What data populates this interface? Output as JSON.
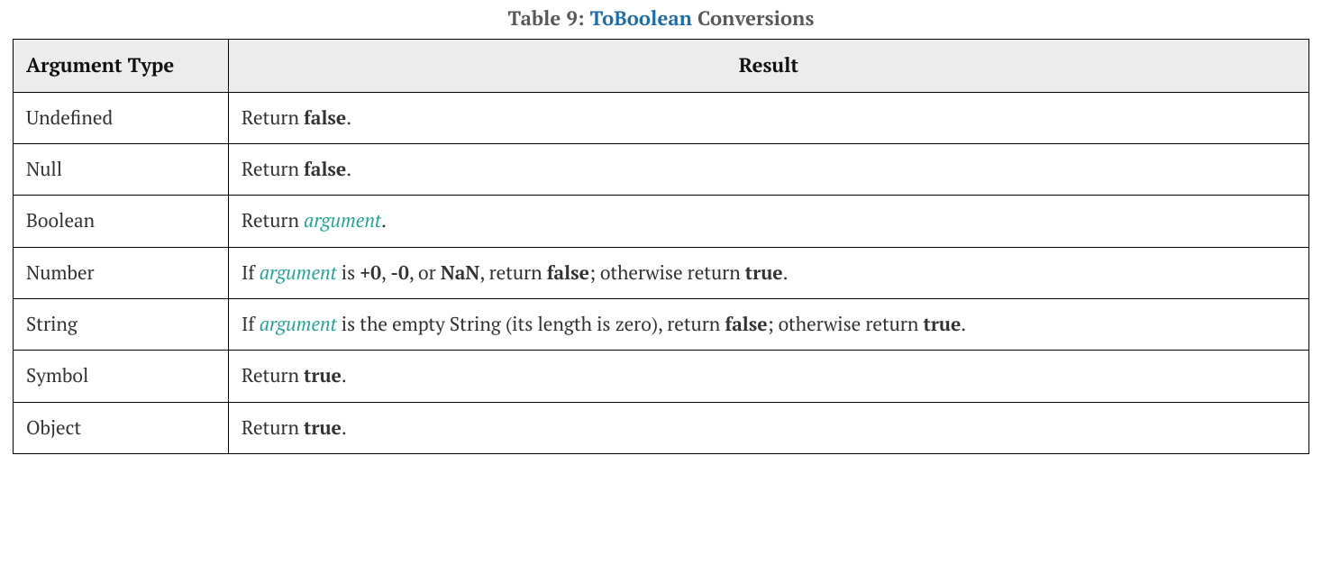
{
  "caption": {
    "prefix": "Table 9: ",
    "operation": "ToBoolean",
    "suffix": " Conversions"
  },
  "headers": {
    "argument_type": "Argument Type",
    "result": "Result"
  },
  "rows": [
    {
      "type": "Undefined",
      "result": [
        {
          "t": "Return ",
          "kind": "plain"
        },
        {
          "t": "false",
          "kind": "bold"
        },
        {
          "t": ".",
          "kind": "plain"
        }
      ]
    },
    {
      "type": "Null",
      "result": [
        {
          "t": "Return ",
          "kind": "plain"
        },
        {
          "t": "false",
          "kind": "bold"
        },
        {
          "t": ".",
          "kind": "plain"
        }
      ]
    },
    {
      "type": "Boolean",
      "result": [
        {
          "t": "Return ",
          "kind": "plain"
        },
        {
          "t": "argument",
          "kind": "arg"
        },
        {
          "t": ".",
          "kind": "plain"
        }
      ]
    },
    {
      "type": "Number",
      "result": [
        {
          "t": "If ",
          "kind": "plain"
        },
        {
          "t": "argument",
          "kind": "arg"
        },
        {
          "t": " is ",
          "kind": "plain"
        },
        {
          "t": "+0",
          "kind": "bold"
        },
        {
          "t": ", ",
          "kind": "plain"
        },
        {
          "t": "-0",
          "kind": "bold"
        },
        {
          "t": ", or ",
          "kind": "plain"
        },
        {
          "t": "NaN",
          "kind": "bold"
        },
        {
          "t": ", return ",
          "kind": "plain"
        },
        {
          "t": "false",
          "kind": "bold"
        },
        {
          "t": "; otherwise return ",
          "kind": "plain"
        },
        {
          "t": "true",
          "kind": "bold"
        },
        {
          "t": ".",
          "kind": "plain"
        }
      ]
    },
    {
      "type": "String",
      "result": [
        {
          "t": "If ",
          "kind": "plain"
        },
        {
          "t": "argument",
          "kind": "arg"
        },
        {
          "t": " is the empty String (its length is zero), return ",
          "kind": "plain"
        },
        {
          "t": "false",
          "kind": "bold"
        },
        {
          "t": "; otherwise return ",
          "kind": "plain"
        },
        {
          "t": "true",
          "kind": "bold"
        },
        {
          "t": ".",
          "kind": "plain"
        }
      ]
    },
    {
      "type": "Symbol",
      "result": [
        {
          "t": "Return ",
          "kind": "plain"
        },
        {
          "t": "true",
          "kind": "bold"
        },
        {
          "t": ".",
          "kind": "plain"
        }
      ]
    },
    {
      "type": "Object",
      "result": [
        {
          "t": "Return ",
          "kind": "plain"
        },
        {
          "t": "true",
          "kind": "bold"
        },
        {
          "t": ".",
          "kind": "plain"
        }
      ]
    }
  ],
  "chart_data": {
    "type": "table",
    "title": "Table 9: ToBoolean Conversions",
    "columns": [
      "Argument Type",
      "Result"
    ],
    "rows": [
      [
        "Undefined",
        "Return false."
      ],
      [
        "Null",
        "Return false."
      ],
      [
        "Boolean",
        "Return argument."
      ],
      [
        "Number",
        "If argument is +0, -0, or NaN, return false; otherwise return true."
      ],
      [
        "String",
        "If argument is the empty String (its length is zero), return false; otherwise return true."
      ],
      [
        "Symbol",
        "Return true."
      ],
      [
        "Object",
        "Return true."
      ]
    ]
  }
}
